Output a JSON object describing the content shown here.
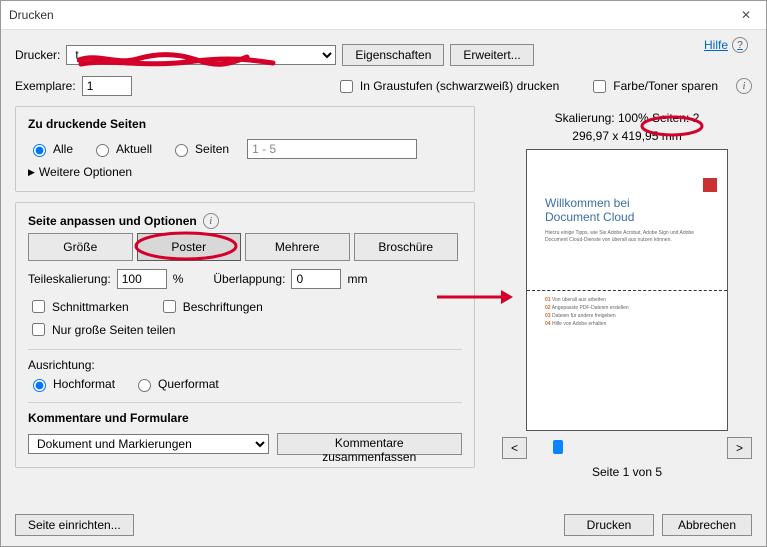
{
  "window": {
    "title": "Drucken",
    "close": "✕"
  },
  "header": {
    "printer_label": "Drucker:",
    "printer_value": "t",
    "properties_btn": "Eigenschaften",
    "advanced_btn": "Erweitert...",
    "help": "Hilfe"
  },
  "line2": {
    "copies_label": "Exemplare:",
    "copies_value": "1",
    "grayscale": "In Graustufen (schwarzweiß) drucken",
    "save_toner": "Farbe/Toner sparen"
  },
  "pages": {
    "group_title": "Zu druckende Seiten",
    "all": "Alle",
    "current": "Aktuell",
    "range": "Seiten",
    "range_value": "1 - 5",
    "more": "Weitere Optionen"
  },
  "sizing": {
    "group_title": "Seite anpassen und Optionen",
    "btn_size": "Größe",
    "btn_poster": "Poster",
    "btn_multiple": "Mehrere",
    "btn_booklet": "Broschüre",
    "tile_label": "Teileskalierung:",
    "tile_value": "100",
    "tile_unit": "%",
    "overlap_label": "Überlappung:",
    "overlap_value": "0",
    "overlap_unit": "mm",
    "cutmarks": "Schnittmarken",
    "labels": "Beschriftungen",
    "only_large": "Nur große Seiten teilen",
    "orient_title": "Ausrichtung:",
    "portrait": "Hochformat",
    "landscape": "Querformat",
    "comments_title": "Kommentare und Formulare",
    "comments_sel": "Dokument und Markierungen",
    "summarize_btn": "Kommentare zusammenfassen"
  },
  "preview": {
    "scale_label": "Skalierung: 100% Seiten: 2",
    "dims": "296,97 x 419,95 mm",
    "doc_title_l1": "Willkommen bei",
    "doc_title_l2": "Document Cloud",
    "doc_sub": "Hierzu einige Tipps, wie Sie Adobe Acrobat, Adobe Sign und Adobe Document Cloud-Dienste von überall aus nutzen können.",
    "b1": "01",
    "t1": "Von überall aus arbeiten",
    "b2": "02",
    "t2": "Angepasste PDF-Dateien erstellen",
    "b3": "03",
    "t3": "Dateien für andere freigeben",
    "b4": "04",
    "t4": "Hilfe von Adobe erhalten",
    "page_of": "Seite 1 von 5",
    "prev": "<",
    "next": ">"
  },
  "footer": {
    "page_setup": "Seite einrichten...",
    "print": "Drucken",
    "cancel": "Abbrechen"
  },
  "colors": {
    "anno": "#d4002a"
  }
}
